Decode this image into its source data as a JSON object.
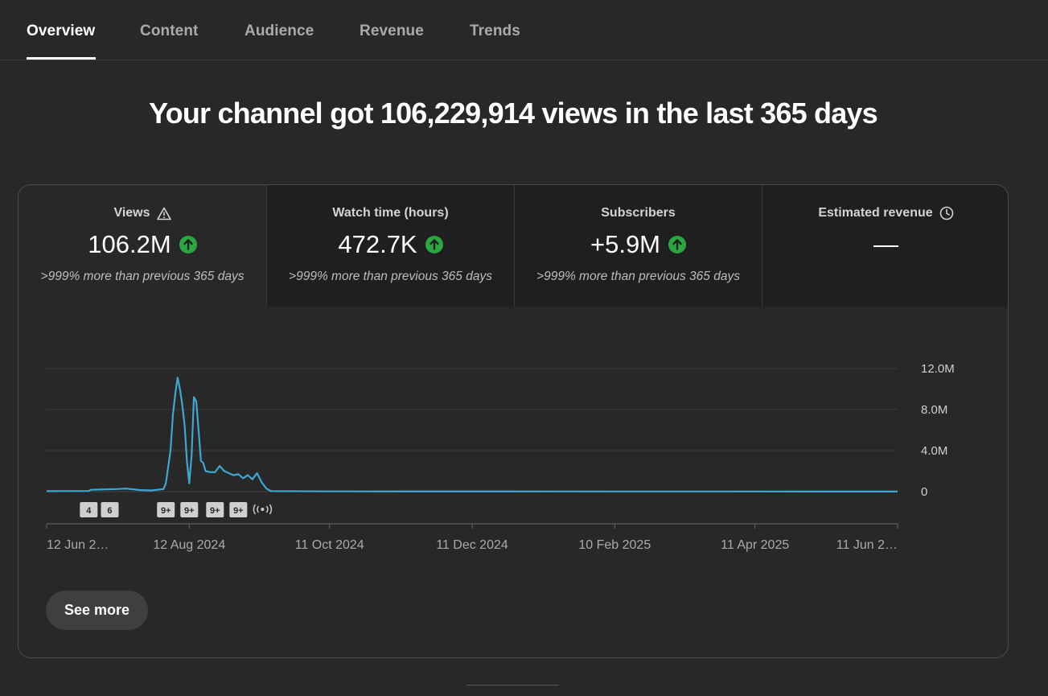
{
  "tabs": [
    "Overview",
    "Content",
    "Audience",
    "Revenue",
    "Trends"
  ],
  "headline": "Your channel got 106,229,914 views in the last 365 days",
  "metrics": [
    {
      "label": "Views",
      "value": "106.2M",
      "sub": ">999% more than previous 365 days",
      "label_icon": "warning-icon",
      "trend": "up"
    },
    {
      "label": "Watch time (hours)",
      "value": "472.7K",
      "sub": ">999% more than previous 365 days",
      "trend": "up"
    },
    {
      "label": "Subscribers",
      "value": "+5.9M",
      "sub": ">999% more than previous 365 days",
      "trend": "up"
    },
    {
      "label": "Estimated revenue",
      "value": "—",
      "label_icon": "clock-icon"
    }
  ],
  "see_more": "See more",
  "colors": {
    "line": "#3ea6d3",
    "up": "#2ba640",
    "background": "#282828"
  },
  "chart_data": {
    "type": "line",
    "y_ticks": [
      "12.0M",
      "8.0M",
      "4.0M",
      "0"
    ],
    "y_tick_values": [
      12000000,
      8000000,
      4000000,
      0
    ],
    "ylim": [
      0,
      12000000
    ],
    "x_tick_labels": [
      "12 Jun 2…",
      "12 Aug 2024",
      "11 Oct 2024",
      "11 Dec 2024",
      "10 Feb 2025",
      "11 Apr 2025",
      "11 Jun 2…"
    ],
    "x_tick_dates": [
      "2024-06-12",
      "2024-08-12",
      "2024-10-11",
      "2024-12-11",
      "2025-02-10",
      "2025-04-11",
      "2025-06-11"
    ],
    "x_range": [
      "2024-06-12",
      "2025-06-11"
    ],
    "grid": true,
    "series": [
      {
        "points": [
          [
            "2024-06-12",
            50000
          ],
          [
            "2024-06-30",
            60000
          ],
          [
            "2024-07-01",
            180000
          ],
          [
            "2024-07-12",
            250000
          ],
          [
            "2024-07-16",
            300000
          ],
          [
            "2024-07-22",
            150000
          ],
          [
            "2024-07-27",
            120000
          ],
          [
            "2024-08-01",
            250000
          ],
          [
            "2024-08-02",
            800000
          ],
          [
            "2024-08-04",
            4000000
          ],
          [
            "2024-08-05",
            7500000
          ],
          [
            "2024-08-06",
            9500000
          ],
          [
            "2024-08-07",
            11100000
          ],
          [
            "2024-08-08",
            10000000
          ],
          [
            "2024-08-09",
            8500000
          ],
          [
            "2024-08-10",
            6500000
          ],
          [
            "2024-08-11",
            3000000
          ],
          [
            "2024-08-12",
            800000
          ],
          [
            "2024-08-13",
            3500000
          ],
          [
            "2024-08-14",
            9200000
          ],
          [
            "2024-08-15",
            8800000
          ],
          [
            "2024-08-16",
            6000000
          ],
          [
            "2024-08-17",
            3000000
          ],
          [
            "2024-08-18",
            2800000
          ],
          [
            "2024-08-19",
            2000000
          ],
          [
            "2024-08-21",
            1900000
          ],
          [
            "2024-08-23",
            1900000
          ],
          [
            "2024-08-25",
            2500000
          ],
          [
            "2024-08-27",
            2000000
          ],
          [
            "2024-08-29",
            1800000
          ],
          [
            "2024-08-31",
            1600000
          ],
          [
            "2024-09-02",
            1700000
          ],
          [
            "2024-09-04",
            1300000
          ],
          [
            "2024-09-06",
            1600000
          ],
          [
            "2024-09-08",
            1200000
          ],
          [
            "2024-09-10",
            1800000
          ],
          [
            "2024-09-12",
            900000
          ],
          [
            "2024-09-14",
            300000
          ],
          [
            "2024-09-16",
            50000
          ],
          [
            "2024-10-11",
            20000
          ],
          [
            "2025-06-11",
            10000
          ]
        ]
      }
    ],
    "event_markers": [
      {
        "label": "4",
        "date": "2024-06-30"
      },
      {
        "label": "6",
        "date": "2024-07-09"
      },
      {
        "label": "9+",
        "date": "2024-08-02"
      },
      {
        "label": "9+",
        "date": "2024-08-12"
      },
      {
        "label": "9+",
        "date": "2024-08-23"
      },
      {
        "label": "9+",
        "date": "2024-09-02"
      },
      {
        "label": "live",
        "date": "2024-09-12",
        "icon": "live-broadcast-icon"
      }
    ]
  }
}
